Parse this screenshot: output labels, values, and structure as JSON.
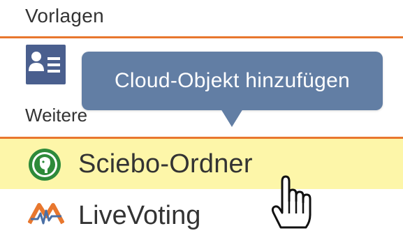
{
  "menu": {
    "section_top_label": "Vorlagen",
    "section_more_label": "Weitere",
    "items": [
      {
        "label": "Sciebo-Ordner",
        "icon": "sciebo-icon",
        "highlighted": true
      },
      {
        "label": "LiveVoting",
        "icon": "livevoting-icon",
        "highlighted": false
      }
    ],
    "contact_icon": "contact-card-icon"
  },
  "tooltip": {
    "text": "Cloud-Objekt hinzufügen"
  },
  "colors": {
    "divider": "#e8772e",
    "tooltip_bg": "#627ea4",
    "highlight_bg": "#fdf6a9",
    "contact_icon_bg": "#4a5f8e",
    "sciebo_green": "#2e8a3a",
    "livevoting_orange": "#e8772e",
    "livevoting_blue": "#4a6fa5"
  },
  "cursor": "hand-pointer-icon"
}
